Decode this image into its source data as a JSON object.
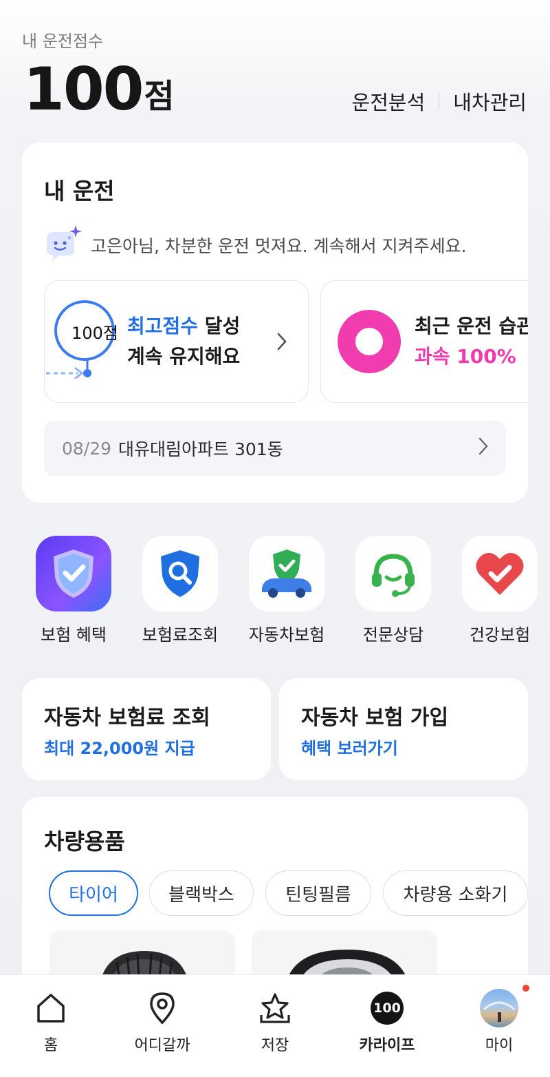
{
  "header": {
    "caption": "내 운전점수",
    "score": "100",
    "score_unit": "점",
    "links": [
      "운전분석",
      "내차관리"
    ]
  },
  "drive": {
    "title": "내 운전",
    "coach_message": "고은아님, 차분한 운전 멋져요. 계속해서 지켜주세요.",
    "card1": {
      "badge": "100점",
      "highlight": "최고점수",
      "line1_rest": " 달성",
      "line2": "계속 유지해요"
    },
    "card2": {
      "line1": "최근 운전 습관",
      "line2": "과속 100%"
    },
    "recent": {
      "date": "08/29",
      "place": "대유대림아파트 301동"
    }
  },
  "shortcuts": [
    {
      "label": "보험 혜택",
      "icon": "shield-check-icon"
    },
    {
      "label": "보험료조회",
      "icon": "shield-search-icon"
    },
    {
      "label": "자동차보험",
      "icon": "car-shield-icon"
    },
    {
      "label": "전문상담",
      "icon": "headset-icon"
    },
    {
      "label": "건강보험",
      "icon": "heart-check-icon"
    }
  ],
  "insurance": [
    {
      "title": "자동차 보험료 조회",
      "subtitle": "최대 22,000원 지급"
    },
    {
      "title": "자동차 보험 가입",
      "subtitle": "혜택 보러가기"
    }
  ],
  "accessories": {
    "title": "차량용품",
    "chips": [
      "타이어",
      "블랙박스",
      "틴팅필름",
      "차량용 소화기"
    ],
    "active_chip": "타이어"
  },
  "nav": [
    {
      "label": "홈",
      "icon": "home-icon"
    },
    {
      "label": "어디갈까",
      "icon": "location-pin-icon"
    },
    {
      "label": "저장",
      "icon": "star-save-icon"
    },
    {
      "label": "카라이프",
      "icon": "score-100-icon",
      "badge": "100"
    },
    {
      "label": "마이",
      "icon": "avatar-icon"
    }
  ],
  "colors": {
    "accent_blue": "#1f6fe0",
    "accent_pink": "#f03cae",
    "notification_red": "#f04438"
  }
}
